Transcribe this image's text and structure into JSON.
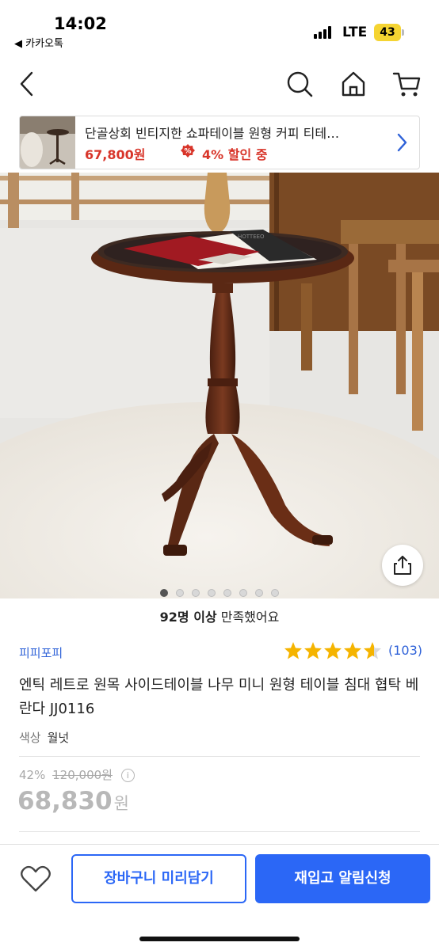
{
  "status_bar": {
    "time": "14:02",
    "back_app": "◀ 카카오톡",
    "network": "LTE",
    "battery": "43"
  },
  "nav": {
    "back_icon": "chevron-left-icon",
    "search_icon": "search-icon",
    "home_icon": "home-icon",
    "cart_icon": "cart-icon"
  },
  "banner": {
    "title": "단골상회 빈티지한 쇼파테이블 원형 커피 티테…",
    "price": "67,800원",
    "discount": "4% 할인 중",
    "accent": "#d8352a"
  },
  "gallery": {
    "image_count": 8,
    "active_index": 0,
    "share_icon": "share-icon",
    "magazine_text": "HOTTEEO"
  },
  "satisfaction": {
    "count": "92명 이상",
    "text": "만족했어요"
  },
  "product": {
    "brand": "피피포피",
    "rating": 4.6,
    "review_count": "(103)",
    "title": "엔틱 레트로 원목 사이드테이블 나무 미니 원형 테이블 침대 협탁 베란다 JJ0116",
    "option_label": "색상",
    "option_value": "월넛",
    "discount_rate": "42%",
    "original_price": "120,000원",
    "info_icon": "i",
    "final_price": "68,830",
    "currency": "원"
  },
  "actions": {
    "cart_button": "장바구니 미리담기",
    "restock_button": "재입고 알림신청",
    "accent": "#2b67f6"
  }
}
